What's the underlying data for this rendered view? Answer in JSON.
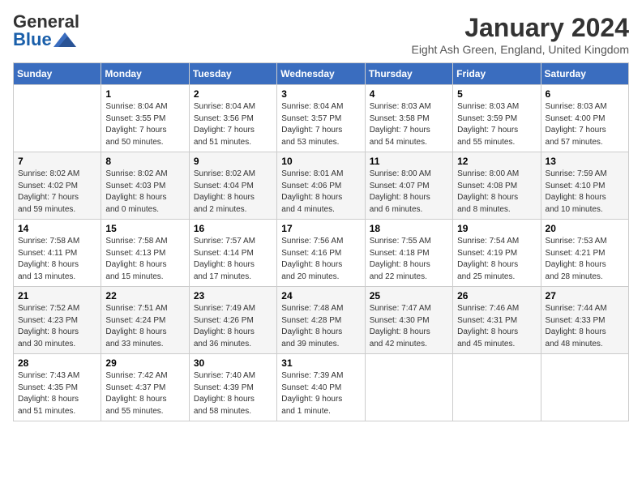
{
  "header": {
    "logo_general": "General",
    "logo_blue": "Blue",
    "month_title": "January 2024",
    "location": "Eight Ash Green, England, United Kingdom"
  },
  "weekdays": [
    "Sunday",
    "Monday",
    "Tuesday",
    "Wednesday",
    "Thursday",
    "Friday",
    "Saturday"
  ],
  "weeks": [
    [
      {
        "day": "",
        "info": ""
      },
      {
        "day": "1",
        "info": "Sunrise: 8:04 AM\nSunset: 3:55 PM\nDaylight: 7 hours\nand 50 minutes."
      },
      {
        "day": "2",
        "info": "Sunrise: 8:04 AM\nSunset: 3:56 PM\nDaylight: 7 hours\nand 51 minutes."
      },
      {
        "day": "3",
        "info": "Sunrise: 8:04 AM\nSunset: 3:57 PM\nDaylight: 7 hours\nand 53 minutes."
      },
      {
        "day": "4",
        "info": "Sunrise: 8:03 AM\nSunset: 3:58 PM\nDaylight: 7 hours\nand 54 minutes."
      },
      {
        "day": "5",
        "info": "Sunrise: 8:03 AM\nSunset: 3:59 PM\nDaylight: 7 hours\nand 55 minutes."
      },
      {
        "day": "6",
        "info": "Sunrise: 8:03 AM\nSunset: 4:00 PM\nDaylight: 7 hours\nand 57 minutes."
      }
    ],
    [
      {
        "day": "7",
        "info": "Sunrise: 8:02 AM\nSunset: 4:02 PM\nDaylight: 7 hours\nand 59 minutes."
      },
      {
        "day": "8",
        "info": "Sunrise: 8:02 AM\nSunset: 4:03 PM\nDaylight: 8 hours\nand 0 minutes."
      },
      {
        "day": "9",
        "info": "Sunrise: 8:02 AM\nSunset: 4:04 PM\nDaylight: 8 hours\nand 2 minutes."
      },
      {
        "day": "10",
        "info": "Sunrise: 8:01 AM\nSunset: 4:06 PM\nDaylight: 8 hours\nand 4 minutes."
      },
      {
        "day": "11",
        "info": "Sunrise: 8:00 AM\nSunset: 4:07 PM\nDaylight: 8 hours\nand 6 minutes."
      },
      {
        "day": "12",
        "info": "Sunrise: 8:00 AM\nSunset: 4:08 PM\nDaylight: 8 hours\nand 8 minutes."
      },
      {
        "day": "13",
        "info": "Sunrise: 7:59 AM\nSunset: 4:10 PM\nDaylight: 8 hours\nand 10 minutes."
      }
    ],
    [
      {
        "day": "14",
        "info": "Sunrise: 7:58 AM\nSunset: 4:11 PM\nDaylight: 8 hours\nand 13 minutes."
      },
      {
        "day": "15",
        "info": "Sunrise: 7:58 AM\nSunset: 4:13 PM\nDaylight: 8 hours\nand 15 minutes."
      },
      {
        "day": "16",
        "info": "Sunrise: 7:57 AM\nSunset: 4:14 PM\nDaylight: 8 hours\nand 17 minutes."
      },
      {
        "day": "17",
        "info": "Sunrise: 7:56 AM\nSunset: 4:16 PM\nDaylight: 8 hours\nand 20 minutes."
      },
      {
        "day": "18",
        "info": "Sunrise: 7:55 AM\nSunset: 4:18 PM\nDaylight: 8 hours\nand 22 minutes."
      },
      {
        "day": "19",
        "info": "Sunrise: 7:54 AM\nSunset: 4:19 PM\nDaylight: 8 hours\nand 25 minutes."
      },
      {
        "day": "20",
        "info": "Sunrise: 7:53 AM\nSunset: 4:21 PM\nDaylight: 8 hours\nand 28 minutes."
      }
    ],
    [
      {
        "day": "21",
        "info": "Sunrise: 7:52 AM\nSunset: 4:23 PM\nDaylight: 8 hours\nand 30 minutes."
      },
      {
        "day": "22",
        "info": "Sunrise: 7:51 AM\nSunset: 4:24 PM\nDaylight: 8 hours\nand 33 minutes."
      },
      {
        "day": "23",
        "info": "Sunrise: 7:49 AM\nSunset: 4:26 PM\nDaylight: 8 hours\nand 36 minutes."
      },
      {
        "day": "24",
        "info": "Sunrise: 7:48 AM\nSunset: 4:28 PM\nDaylight: 8 hours\nand 39 minutes."
      },
      {
        "day": "25",
        "info": "Sunrise: 7:47 AM\nSunset: 4:30 PM\nDaylight: 8 hours\nand 42 minutes."
      },
      {
        "day": "26",
        "info": "Sunrise: 7:46 AM\nSunset: 4:31 PM\nDaylight: 8 hours\nand 45 minutes."
      },
      {
        "day": "27",
        "info": "Sunrise: 7:44 AM\nSunset: 4:33 PM\nDaylight: 8 hours\nand 48 minutes."
      }
    ],
    [
      {
        "day": "28",
        "info": "Sunrise: 7:43 AM\nSunset: 4:35 PM\nDaylight: 8 hours\nand 51 minutes."
      },
      {
        "day": "29",
        "info": "Sunrise: 7:42 AM\nSunset: 4:37 PM\nDaylight: 8 hours\nand 55 minutes."
      },
      {
        "day": "30",
        "info": "Sunrise: 7:40 AM\nSunset: 4:39 PM\nDaylight: 8 hours\nand 58 minutes."
      },
      {
        "day": "31",
        "info": "Sunrise: 7:39 AM\nSunset: 4:40 PM\nDaylight: 9 hours\nand 1 minute."
      },
      {
        "day": "",
        "info": ""
      },
      {
        "day": "",
        "info": ""
      },
      {
        "day": "",
        "info": ""
      }
    ]
  ]
}
